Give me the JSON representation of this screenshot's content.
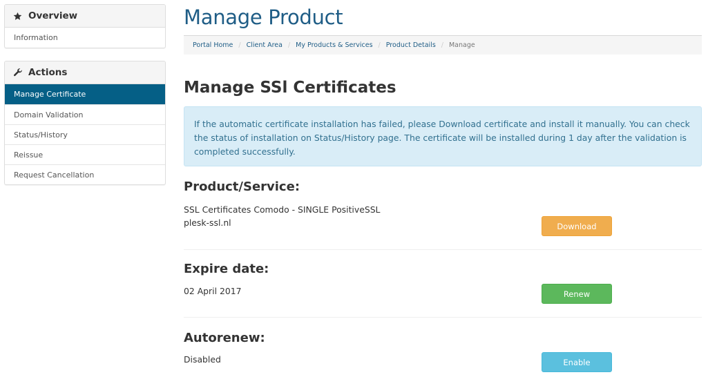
{
  "sidebar": {
    "overview": {
      "title": "Overview",
      "icon": "star-icon",
      "items": [
        {
          "label": "Information"
        }
      ]
    },
    "actions": {
      "title": "Actions",
      "icon": "wrench-icon",
      "items": [
        {
          "label": "Manage Certificate",
          "active": true
        },
        {
          "label": "Domain Validation"
        },
        {
          "label": "Status/History"
        },
        {
          "label": "Reissue"
        },
        {
          "label": "Request Cancellation"
        }
      ]
    }
  },
  "header": {
    "title": "Manage Product",
    "breadcrumb": [
      {
        "label": "Portal Home"
      },
      {
        "label": "Client Area"
      },
      {
        "label": "My Products & Services"
      },
      {
        "label": "Product Details"
      },
      {
        "label": "Manage",
        "current": true
      }
    ],
    "breadcrumb_separator": "/"
  },
  "main": {
    "title": "Manage SSl Certificates",
    "alert": "If the automatic certificate installation has failed, please Download certificate and install it manually. You can check the status of installation on Status/History page. The certificate will be installed during 1 day after the validation is completed successfully.",
    "product": {
      "label": "Product/Service:",
      "name": "SSL Certificates Comodo - SINGLE PositiveSSL",
      "domain": "plesk-ssl.nl",
      "button": "Download"
    },
    "expire": {
      "label": "Expire date:",
      "value": "02 April 2017",
      "button": "Renew"
    },
    "autorenew": {
      "label": "Autorenew:",
      "value": "Disabled",
      "button": "Enable"
    }
  },
  "colors": {
    "primary": "#055f86",
    "title": "#1f5d86",
    "download": "#f0ad4e",
    "renew": "#5cb85c",
    "enable": "#5bc0de",
    "alert_bg": "#d9edf7"
  }
}
